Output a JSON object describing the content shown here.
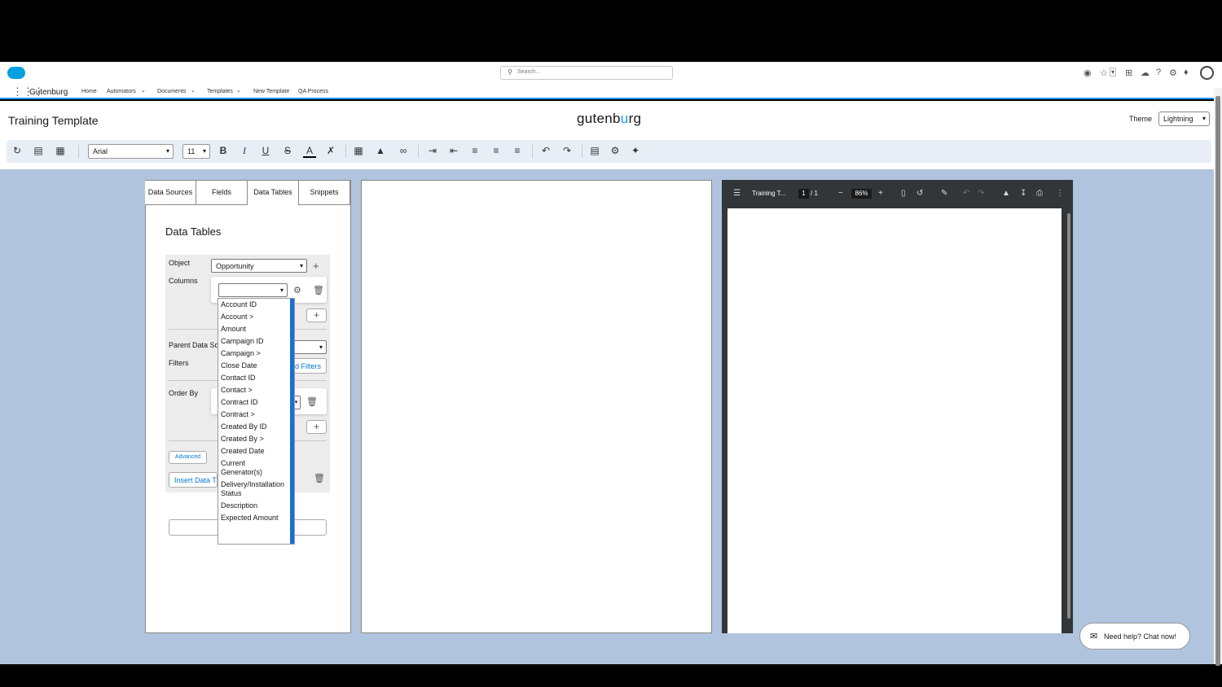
{
  "global": {
    "search_placeholder": "Search...",
    "app_name": "Gutenburg",
    "nav": [
      "Home",
      "Automators",
      "Documents",
      "Templates",
      "New Template",
      "QA Process"
    ]
  },
  "header": {
    "title": "Training Template",
    "brand_pre": "gutenb",
    "brand_accent": "u",
    "brand_post": "rg",
    "theme_label": "Theme",
    "theme_value": "Lightning"
  },
  "toolbar": {
    "font": "Arial",
    "size": "11"
  },
  "left_panel": {
    "tabs": [
      "Data Sources",
      "Fields",
      "Data Tables",
      "Snippets"
    ],
    "active_tab": "Data Tables",
    "heading": "Data Tables",
    "object_label": "Object",
    "object_value": "Opportunity",
    "columns_label": "Columns",
    "parent_label": "Parent Data So",
    "filters_label": "Filters",
    "filters_button": "d Filters",
    "order_label": "Order By",
    "advanced_button": "Advanced",
    "insert_button": "Insert Data T"
  },
  "dropdown": {
    "options": [
      "Account ID",
      "Account >",
      "Amount",
      "Campaign ID",
      "Campaign >",
      "Close Date",
      "Contact ID",
      "Contact >",
      "Contract ID",
      "Contract >",
      "Created By ID",
      "Created By >",
      "Created Date",
      "Current Generator(s)",
      "Delivery/Installation Status",
      "Description",
      "Expected Amount"
    ]
  },
  "pdf": {
    "title": "Training T...",
    "page": "1",
    "total": "/ 1",
    "zoom": "86%"
  },
  "chat": {
    "label": "Need help? Chat now!"
  },
  "colors": {
    "accent": "#1b96ff",
    "workspace": "#b0c4de",
    "link": "#0176d3"
  }
}
